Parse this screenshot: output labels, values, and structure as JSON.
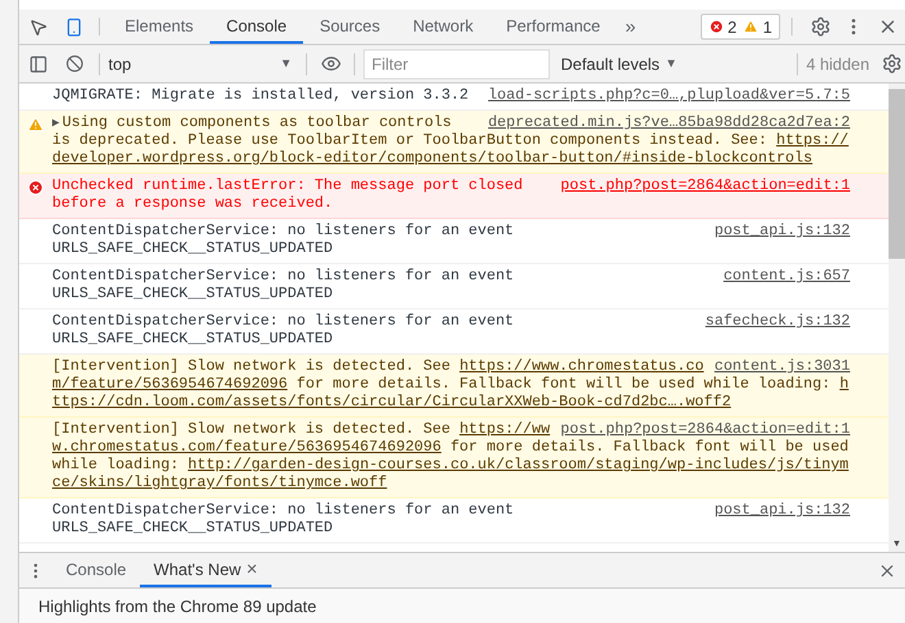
{
  "tabs": [
    {
      "label": "Elements",
      "selected": false
    },
    {
      "label": "Console",
      "selected": true
    },
    {
      "label": "Sources",
      "selected": false
    },
    {
      "label": "Network",
      "selected": false
    },
    {
      "label": "Performance",
      "selected": false
    }
  ],
  "more_tabs": "»",
  "issues": {
    "errors": "2",
    "warnings": "1"
  },
  "console_toolbar": {
    "context": "top",
    "dropdown_arrow": "▼",
    "scroll_down_arrow": "▼",
    "filter_placeholder": "Filter",
    "levels": "Default levels",
    "hidden": "4 hidden"
  },
  "messages": [
    {
      "kind": "log",
      "source": "load-scripts.php?c=0…,plupload&ver=5.7:5",
      "lines": [
        [
          {
            "text": "JQMIGRATE: Migrate is installed, version 3.3.2"
          }
        ]
      ]
    },
    {
      "kind": "warning",
      "icon": true,
      "expander": "▶",
      "source": "deprecated.min.js?ve…85ba98dd28ca2d7ea:2",
      "lines": [
        [
          {
            "text": "Using custom components as toolbar controls"
          }
        ],
        [
          {
            "text": "is deprecated. Please use ToolbarItem or ToolbarButton components instead. See: "
          },
          {
            "text": "https://",
            "link": true
          }
        ],
        [
          {
            "text": "developer.wordpress.org/block-editor/components/toolbar-button/#inside-blockcontrols",
            "link": true
          }
        ]
      ]
    },
    {
      "kind": "error",
      "icon": true,
      "source": "post.php?post=2864&action=edit:1",
      "lines": [
        [
          {
            "text": "Unchecked runtime.lastError: The message port closed"
          }
        ],
        [
          {
            "text": "before a response was received."
          }
        ]
      ]
    },
    {
      "kind": "log",
      "source": "post_api.js:132",
      "lines": [
        [
          {
            "text": "ContentDispatcherService: no listeners for an event"
          }
        ],
        [
          {
            "text": "URLS_SAFE_CHECK__STATUS_UPDATED"
          }
        ]
      ]
    },
    {
      "kind": "log",
      "source": "content.js:657",
      "lines": [
        [
          {
            "text": "ContentDispatcherService: no listeners for an event"
          }
        ],
        [
          {
            "text": "URLS_SAFE_CHECK__STATUS_UPDATED"
          }
        ]
      ]
    },
    {
      "kind": "log",
      "source": "safecheck.js:132",
      "lines": [
        [
          {
            "text": "ContentDispatcherService: no listeners for an event"
          }
        ],
        [
          {
            "text": "URLS_SAFE_CHECK__STATUS_UPDATED"
          }
        ]
      ]
    },
    {
      "kind": "warning",
      "icon": false,
      "source": "content.js:3031",
      "lines": [
        [
          {
            "text": "[Intervention] Slow network is detected. See "
          },
          {
            "text": "https://www.chromestatus.co",
            "link": true
          }
        ],
        [
          {
            "text": "m/feature/5636954674692096",
            "link": true
          },
          {
            "text": " for more details. Fallback font will be used while loading: "
          },
          {
            "text": "h",
            "link": true
          }
        ],
        [
          {
            "text": "ttps://cdn.loom.com/assets/fonts/circular/CircularXXWeb-Book-cd7d2bc….woff2",
            "link": true
          }
        ]
      ]
    },
    {
      "kind": "warning",
      "icon": false,
      "source": "post.php?post=2864&action=edit:1",
      "lines": [
        [
          {
            "text": "[Intervention] Slow network is detected. See "
          },
          {
            "text": "https://ww",
            "link": true
          }
        ],
        [
          {
            "text": "w.chromestatus.com/feature/5636954674692096",
            "link": true
          },
          {
            "text": " for more details. Fallback font will be used"
          }
        ],
        [
          {
            "text": "while loading: "
          },
          {
            "text": "http://garden-design-courses.co.uk/classroom/staging/wp-includes/js/tinym",
            "link": true
          }
        ],
        [
          {
            "text": "ce/skins/lightgray/fonts/tinymce.woff",
            "link": true
          }
        ]
      ]
    },
    {
      "kind": "log",
      "source": "post_api.js:132",
      "lines": [
        [
          {
            "text": "ContentDispatcherService: no listeners for an event"
          }
        ],
        [
          {
            "text": "URLS_SAFE_CHECK__STATUS_UPDATED"
          }
        ]
      ]
    }
  ],
  "drawer": {
    "tabs": [
      {
        "label": "Console",
        "selected": false,
        "closable": false
      },
      {
        "label": "What's New",
        "selected": true,
        "closable": true
      }
    ],
    "close_glyph": "×",
    "content": "Highlights from the Chrome 89 update"
  }
}
